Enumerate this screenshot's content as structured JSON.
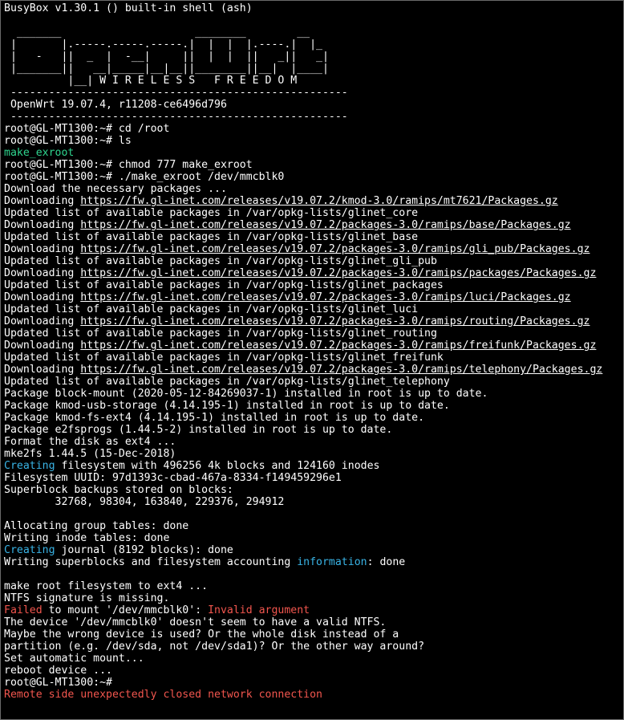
{
  "terminal": {
    "header": "BusyBox v1.30.1 () built-in shell (ash)",
    "banner": [
      "",
      "  _______                     ________        __",
      " |       |.-----.-----.-----.|  |  |  |.----.|  |_",
      " |   -   ||  _  |  -__|     ||  |  |  ||   _||   _|",
      " |_______||   __|_____|__|__||________||__|  |____|",
      "          |__| W I R E L E S S   F R E E D O M",
      " -----------------------------------------------------",
      " OpenWrt 19.07.4, r11208-ce6496d796",
      " -----------------------------------------------------"
    ],
    "lines": [
      [
        {
          "t": "root@GL-MT1300:~# cd /root"
        }
      ],
      [
        {
          "t": "root@GL-MT1300:~# ls"
        }
      ],
      [
        {
          "t": "make_exroot",
          "c": "green"
        }
      ],
      [
        {
          "t": "root@GL-MT1300:~# chmod 777 make_exroot"
        }
      ],
      [
        {
          "t": "root@GL-MT1300:~# ./make_exroot /dev/mmcblk0"
        }
      ],
      [
        {
          "t": "Download the necessary packages ..."
        }
      ],
      [
        {
          "t": "Downloading "
        },
        {
          "t": "https://fw.gl-inet.com/releases/v19.07.2/kmod-3.0/ramips/mt7621/Packages.gz",
          "c": "url"
        }
      ],
      [
        {
          "t": "Updated list of available packages in /var/opkg-lists/glinet_core"
        }
      ],
      [
        {
          "t": "Downloading "
        },
        {
          "t": "https://fw.gl-inet.com/releases/v19.07.2/packages-3.0/ramips/base/Packages.gz",
          "c": "url"
        }
      ],
      [
        {
          "t": "Updated list of available packages in /var/opkg-lists/glinet_base"
        }
      ],
      [
        {
          "t": "Downloading "
        },
        {
          "t": "https://fw.gl-inet.com/releases/v19.07.2/packages-3.0/ramips/gli_pub/Packages.gz",
          "c": "url"
        }
      ],
      [
        {
          "t": "Updated list of available packages in /var/opkg-lists/glinet_gli_pub"
        }
      ],
      [
        {
          "t": "Downloading "
        },
        {
          "t": "https://fw.gl-inet.com/releases/v19.07.2/packages-3.0/ramips/packages/Packages.gz",
          "c": "url"
        }
      ],
      [
        {
          "t": "Updated list of available packages in /var/opkg-lists/glinet_packages"
        }
      ],
      [
        {
          "t": "Downloading "
        },
        {
          "t": "https://fw.gl-inet.com/releases/v19.07.2/packages-3.0/ramips/luci/Packages.gz",
          "c": "url"
        }
      ],
      [
        {
          "t": "Updated list of available packages in /var/opkg-lists/glinet_luci"
        }
      ],
      [
        {
          "t": "Downloading "
        },
        {
          "t": "https://fw.gl-inet.com/releases/v19.07.2/packages-3.0/ramips/routing/Packages.gz",
          "c": "url"
        }
      ],
      [
        {
          "t": "Updated list of available packages in /var/opkg-lists/glinet_routing"
        }
      ],
      [
        {
          "t": "Downloading "
        },
        {
          "t": "https://fw.gl-inet.com/releases/v19.07.2/packages-3.0/ramips/freifunk/Packages.gz",
          "c": "url"
        }
      ],
      [
        {
          "t": "Updated list of available packages in /var/opkg-lists/glinet_freifunk"
        }
      ],
      [
        {
          "t": "Downloading "
        },
        {
          "t": "https://fw.gl-inet.com/releases/v19.07.2/packages-3.0/ramips/telephony/Packages.gz",
          "c": "url"
        }
      ],
      [
        {
          "t": "Updated list of available packages in /var/opkg-lists/glinet_telephony"
        }
      ],
      [
        {
          "t": "Package block-mount (2020-05-12-84269037-1) installed in root is up to date."
        }
      ],
      [
        {
          "t": "Package kmod-usb-storage (4.14.195-1) installed in root is up to date."
        }
      ],
      [
        {
          "t": "Package kmod-fs-ext4 (4.14.195-1) installed in root is up to date."
        }
      ],
      [
        {
          "t": "Package e2fsprogs (1.44.5-2) installed in root is up to date."
        }
      ],
      [
        {
          "t": "Format the disk as ext4 ..."
        }
      ],
      [
        {
          "t": "mke2fs 1.44.5 (15-Dec-2018)"
        }
      ],
      [
        {
          "t": "Creating",
          "c": "cyan"
        },
        {
          "t": " filesystem with 496256 4k blocks and 124160 inodes"
        }
      ],
      [
        {
          "t": "Filesystem UUID: 97d1393c-cbad-467a-8334-f149459296e1"
        }
      ],
      [
        {
          "t": "Superblock backups stored on blocks:"
        }
      ],
      [
        {
          "t": "        32768, 98304, 163840, 229376, 294912"
        }
      ],
      [
        {
          "t": ""
        }
      ],
      [
        {
          "t": "Allocating group tables: done"
        }
      ],
      [
        {
          "t": "Writing inode tables: done"
        }
      ],
      [
        {
          "t": "Creating",
          "c": "cyan"
        },
        {
          "t": " journal (8192 blocks): done"
        }
      ],
      [
        {
          "t": "Writing superblocks and filesystem accounting "
        },
        {
          "t": "information",
          "c": "cyan"
        },
        {
          "t": ": done"
        }
      ],
      [
        {
          "t": ""
        }
      ],
      [
        {
          "t": "make root filesystem to ext4 ..."
        }
      ],
      [
        {
          "t": "NTFS signature is missing."
        }
      ],
      [
        {
          "t": "Failed",
          "c": "red"
        },
        {
          "t": " to mount '/dev/mmcblk0': "
        },
        {
          "t": "Invalid argument",
          "c": "red"
        }
      ],
      [
        {
          "t": "The device '/dev/mmcblk0' doesn't seem to have a valid NTFS."
        }
      ],
      [
        {
          "t": "Maybe the wrong device is used? Or the whole disk instead of a"
        }
      ],
      [
        {
          "t": "partition (e.g. /dev/sda, not /dev/sda1)? Or the other way around?"
        }
      ],
      [
        {
          "t": "Set automatic mount..."
        }
      ],
      [
        {
          "t": "reboot device ..."
        }
      ],
      [
        {
          "t": "root@GL-MT1300:~# "
        }
      ],
      [
        {
          "t": "Remote side unexpectedly closed network connection",
          "c": "red"
        }
      ]
    ]
  },
  "colors": {
    "background": "#000000",
    "text": "#ffffff",
    "green": "#2fd58f",
    "cyan": "#39b4e6",
    "red": "#f2564e"
  }
}
